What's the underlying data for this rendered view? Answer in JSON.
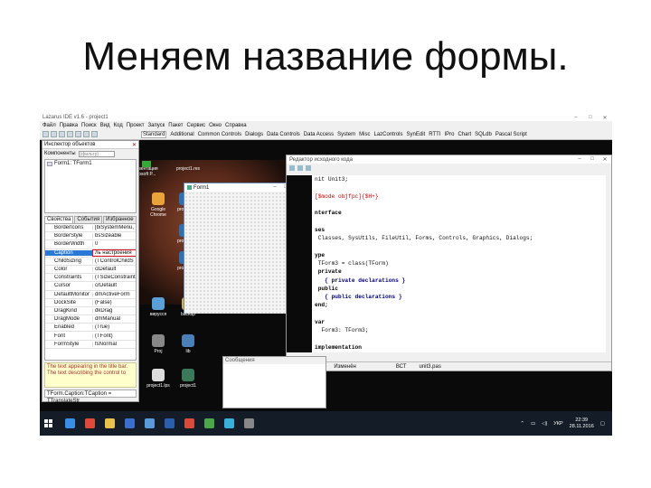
{
  "slide_title": "Меняем название формы.",
  "ide": {
    "title": "Lazarus IDE v1.6 - project1",
    "menu": [
      "Файл",
      "Правка",
      "Поиск",
      "Вид",
      "Код",
      "Проект",
      "Запуск",
      "Пакет",
      "Сервис",
      "Окно",
      "Справка"
    ],
    "palette_tabs": [
      "Standard",
      "Additional",
      "Common Controls",
      "Dialogs",
      "Data Controls",
      "Data Access",
      "System",
      "Misc",
      "LazControls",
      "SynEdit",
      "RTTI",
      "IPro",
      "Chart",
      "SQLdb",
      "Pascal Script"
    ]
  },
  "inspector": {
    "title": "Инспектор объектов",
    "components_label": "Компоненты",
    "filter_placeholder": "(фильтр)",
    "tree_node": "Form1: TForm1",
    "tabs": [
      "Свойства",
      "События",
      "Избранное"
    ],
    "properties": [
      {
        "name": "BorderIcons",
        "value": "[biSystemMenu,"
      },
      {
        "name": "BorderStyle",
        "value": "bsSizeable"
      },
      {
        "name": "BorderWidth",
        "value": "0"
      },
      {
        "name": "Caption",
        "value": "ль настроения"
      },
      {
        "name": "ChildSizing",
        "value": "(TControlChildS"
      },
      {
        "name": "Color",
        "value": "clDefault"
      },
      {
        "name": "Constraints",
        "value": "(TSizeConstraint"
      },
      {
        "name": "Cursor",
        "value": "crDefault"
      },
      {
        "name": "DefaultMonitor",
        "value": "dmActiveForm"
      },
      {
        "name": "DockSite",
        "value": "(False)"
      },
      {
        "name": "DragKind",
        "value": "dkDrag"
      },
      {
        "name": "DragMode",
        "value": "dmManual"
      },
      {
        "name": "Enabled",
        "value": "(True)"
      },
      {
        "name": "Font",
        "value": "(TFont)"
      },
      {
        "name": "FormStyle",
        "value": "fsNormal"
      }
    ],
    "hint_line1": "The text appearing in the title bar.",
    "hint_line2": "The text describing the control to",
    "status": "TForm.Caption:TCaption = TTranslateStr"
  },
  "desktop_icons": [
    {
      "label": "Google Chrome",
      "color": "#e8a33a"
    },
    {
      "label": "project1",
      "color": "#2f6fb3"
    },
    {
      "label": "project1",
      "color": "#2f6fb3"
    },
    {
      "label": "project1",
      "color": "#2f6fb3"
    },
    {
      "label": "вирусся",
      "color": "#5a9fd8"
    },
    {
      "label": "backup",
      "color": "#d6b33a"
    },
    {
      "label": "Proj",
      "color": "#888888"
    },
    {
      "label": "lib",
      "color": "#4a7fb8"
    },
    {
      "label": "project1.lps",
      "color": "#dddddd"
    },
    {
      "label": "project1",
      "color": "#3a7a5a"
    }
  ],
  "desktop_top_labels": {
    "line1": "резентация",
    "line2": "icrosoft P..."
  },
  "desktop_top_icon": "project1.res",
  "form1": {
    "title": "Form1"
  },
  "editor": {
    "title": "Редактор исходного кода",
    "tab": "Unit1",
    "code_lines": [
      {
        "t": "nit Unit3;",
        "c": ""
      },
      {
        "t": "",
        "c": ""
      },
      {
        "t": "[$mode objfpc]{$H+}",
        "c": "dir"
      },
      {
        "t": "",
        "c": ""
      },
      {
        "t": "nterface",
        "c": "kw"
      },
      {
        "t": "",
        "c": ""
      },
      {
        "t": "ses",
        "c": "kw"
      },
      {
        "t": " Classes, SysUtils, FileUtil, Forms, Controls, Graphics, Dialogs;",
        "c": ""
      },
      {
        "t": "",
        "c": ""
      },
      {
        "t": "ype",
        "c": "kw"
      },
      {
        "t": " TForm3 = class(TForm)",
        "c": ""
      },
      {
        "t": " private",
        "c": "kw"
      },
      {
        "t": "   { private declarations }",
        "c": "cm"
      },
      {
        "t": " public",
        "c": "kw"
      },
      {
        "t": "   { public declarations }",
        "c": "cm"
      },
      {
        "t": "end;",
        "c": "kw"
      },
      {
        "t": "",
        "c": ""
      },
      {
        "t": "var",
        "c": "kw"
      },
      {
        "t": "  Form3: TForm3;",
        "c": ""
      },
      {
        "t": "",
        "c": ""
      },
      {
        "t": "implementation",
        "c": "kw"
      },
      {
        "t": "",
        "c": ""
      },
      {
        "t": "{$R *.lfm}",
        "c": "dir"
      }
    ],
    "status": {
      "line": "1:",
      "col": "1",
      "modified": "Изменён",
      "mode": "ВСТ",
      "file": "unit3.pas"
    }
  },
  "messages": {
    "title": "Сообщения"
  },
  "taskbar": {
    "apps": [
      "#3a8ee6",
      "#e04a3a",
      "#e8c24a",
      "#3a6fd0",
      "#5a9ad8",
      "#2a5fae",
      "#d84a3a",
      "#4aa84a",
      "#3ab0d8",
      "#888888"
    ],
    "lang": "УКР",
    "time": "22:39",
    "date": "28.11.2016"
  }
}
